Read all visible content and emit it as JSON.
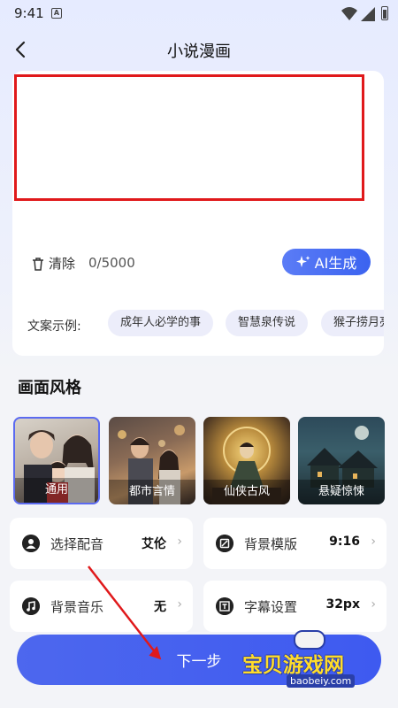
{
  "status": {
    "time": "9:41",
    "a_icon": "A"
  },
  "header": {
    "title": "小说漫画",
    "back_icon": "chevron-left-icon"
  },
  "editor": {
    "clear_label": "清除",
    "count": "0/5000",
    "ai_label": "AI生成",
    "examples_label": "文案示例:",
    "examples": [
      "成年人必学的事",
      "智慧泉传说",
      "猴子捞月亮"
    ]
  },
  "style_section": {
    "title": "画面风格",
    "styles": [
      {
        "name": "通用",
        "selected": true
      },
      {
        "name": "都市言情",
        "selected": false
      },
      {
        "name": "仙侠古风",
        "selected": false
      },
      {
        "name": "悬疑惊悚",
        "selected": false
      }
    ]
  },
  "options": [
    {
      "icon": "person-icon",
      "label": "选择配音",
      "value": "艾伦"
    },
    {
      "icon": "template-icon",
      "label": "背景模版",
      "value": "9:16"
    },
    {
      "icon": "music-icon",
      "label": "背景音乐",
      "value": "无"
    },
    {
      "icon": "subtitle-icon",
      "label": "字幕设置",
      "value": "32px"
    }
  ],
  "footer": {
    "next_label": "下一步"
  },
  "watermark": {
    "text": "宝贝游戏网",
    "url": "baobeiy.com"
  },
  "colors": {
    "accent": "#4a63ef",
    "highlight": "#e0191b"
  }
}
